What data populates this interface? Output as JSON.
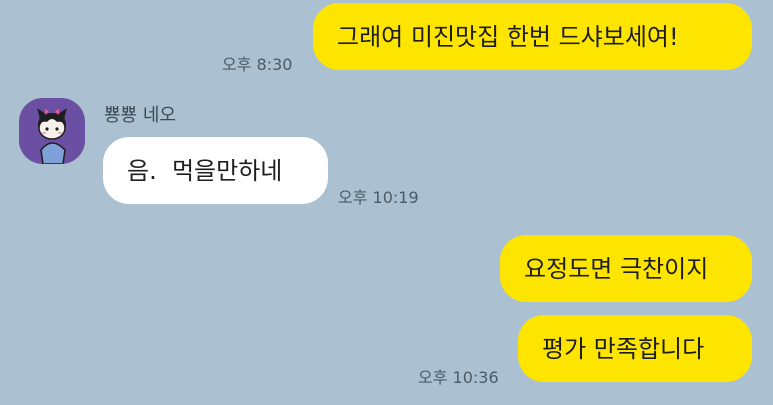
{
  "messages": [
    {
      "text": "그래여 미진맛집 한번 드샤보세여!",
      "time": "오후 8:30",
      "from": "me"
    },
    {
      "sender": "뿅뿅 네오",
      "text": "음.  먹을만하네",
      "time": "오후 10:19",
      "from": "other",
      "avatar_icon": "neo-cat-avatar-icon"
    },
    {
      "text": "요정도면 극찬이지",
      "from": "me"
    },
    {
      "text": "평가 만족합니다",
      "time": "오후 10:36",
      "from": "me"
    }
  ],
  "colors": {
    "background": "#abc1d1",
    "my_bubble": "#fee500",
    "their_bubble": "#ffffff",
    "avatar_bg": "#6b4fa3"
  }
}
